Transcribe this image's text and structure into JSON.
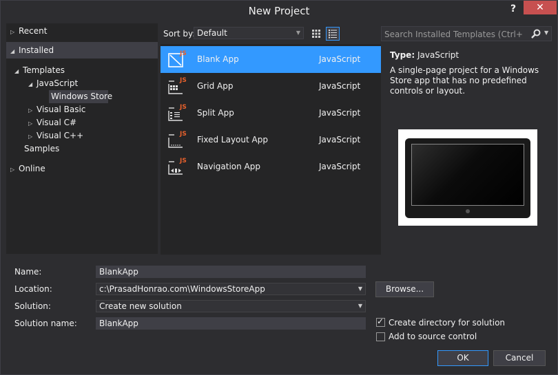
{
  "window": {
    "title": "New Project",
    "help_label": "?",
    "close_label": "✕"
  },
  "tree": {
    "recent": "Recent",
    "installed": "Installed",
    "templates": "Templates",
    "javascript": "JavaScript",
    "windows_store": "Windows Store",
    "visual_basic": "Visual Basic",
    "visual_csharp": "Visual C#",
    "visual_cpp": "Visual C++",
    "samples": "Samples",
    "online": "Online"
  },
  "sort": {
    "label": "Sort by:",
    "value": "Default"
  },
  "search": {
    "placeholder": "Search Installed Templates (Ctrl+E)"
  },
  "templates": [
    {
      "name": "Blank App",
      "lang": "JavaScript",
      "icon": "blank-app-icon"
    },
    {
      "name": "Grid App",
      "lang": "JavaScript",
      "icon": "grid-app-icon"
    },
    {
      "name": "Split App",
      "lang": "JavaScript",
      "icon": "split-app-icon"
    },
    {
      "name": "Fixed Layout App",
      "lang": "JavaScript",
      "icon": "fixed-layout-app-icon"
    },
    {
      "name": "Navigation App",
      "lang": "JavaScript",
      "icon": "navigation-app-icon"
    }
  ],
  "info": {
    "type_label": "Type:",
    "type_value": "JavaScript",
    "description": "A single-page project for a Windows Store app that has no predefined controls or layout."
  },
  "form": {
    "name_label": "Name:",
    "name_value": "BlankApp",
    "location_label": "Location:",
    "location_value": "c:\\PrasadHonrao.com\\WindowsStoreApp",
    "solution_label": "Solution:",
    "solution_value": "Create new solution",
    "solution_name_label": "Solution name:",
    "solution_name_value": "BlankApp",
    "browse_label": "Browse...",
    "create_dir_label": "Create directory for solution",
    "create_dir_checked": true,
    "source_control_label": "Add to source control",
    "source_control_checked": false,
    "ok_label": "OK",
    "cancel_label": "Cancel"
  },
  "colors": {
    "accent": "#3399ff",
    "js_badge": "#e8612c",
    "close": "#c75050"
  }
}
